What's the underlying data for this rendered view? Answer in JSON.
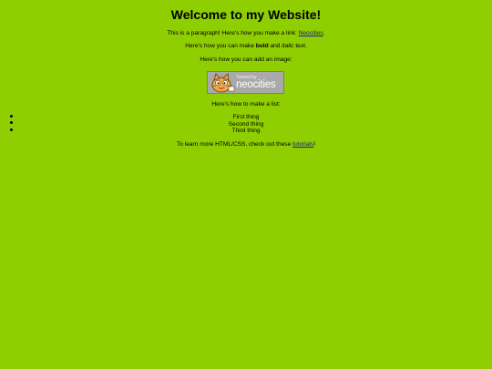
{
  "heading": "Welcome to my Website!",
  "para1": {
    "before": "This is a paragraph! Here's how you make a link: ",
    "link": "Neocities",
    "after": "."
  },
  "para2": {
    "before": "Here's how you can make ",
    "bold": "bold",
    "middle": " and ",
    "italic": "italic",
    "after": " text."
  },
  "para3": "Here's how you can add an image:",
  "badge": {
    "small_text": "hosted by",
    "brand_text": "neocities",
    "icon": "neocities-cat-icon"
  },
  "para4": "Here's how to make a list:",
  "list_items": [
    "First thing",
    "Second thing",
    "Third thing"
  ],
  "para5": {
    "before": "To learn more HTML/CSS, check out these ",
    "link": "tutorials",
    "after": "!"
  },
  "colors": {
    "background": "#8fce00",
    "link": "#1a237e",
    "badge_bg": "#a9a9a9"
  }
}
